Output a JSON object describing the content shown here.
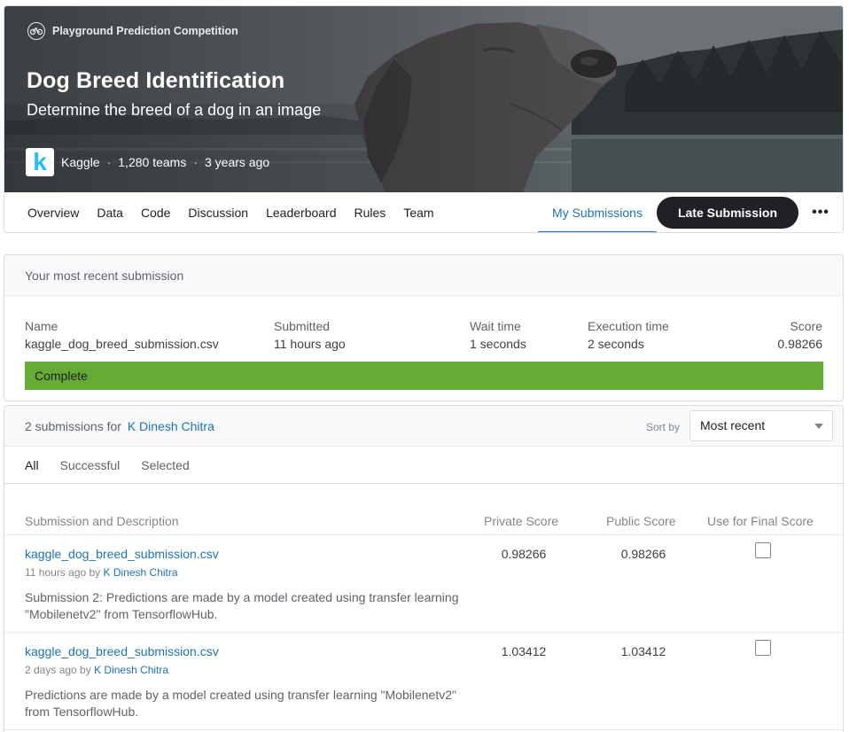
{
  "header": {
    "competition_type": "Playground Prediction Competition",
    "title": "Dog Breed Identification",
    "subtitle": "Determine the breed of a dog in an image",
    "host_logo_letter": "k",
    "host": "Kaggle",
    "teams": "1,280 teams",
    "age": "3 years ago",
    "separator": "·"
  },
  "tabs": {
    "overview": "Overview",
    "data": "Data",
    "code": "Code",
    "discussion": "Discussion",
    "leaderboard": "Leaderboard",
    "rules": "Rules",
    "team": "Team",
    "my_submissions": "My Submissions",
    "late_submission": "Late Submission",
    "more": "•••",
    "active": "My Submissions"
  },
  "recent": {
    "heading": "Your most recent submission",
    "name_label": "Name",
    "name_value": "kaggle_dog_breed_submission.csv",
    "submitted_label": "Submitted",
    "submitted_value": "11 hours ago",
    "wait_label": "Wait time",
    "wait_value": "1 seconds",
    "exec_label": "Execution time",
    "exec_value": "2 seconds",
    "score_label": "Score",
    "score_value": "0.98266",
    "status": "Complete",
    "status_color": "#66ab35"
  },
  "submissions": {
    "count_text": "2 submissions for",
    "user": "K Dinesh Chitra",
    "sort_label": "Sort by",
    "sort_value": "Most recent",
    "filters": [
      "All",
      "Successful",
      "Selected"
    ],
    "active_filter": "All",
    "columns": {
      "description": "Submission and Description",
      "private": "Private Score",
      "public": "Public Score",
      "final": "Use for Final Score"
    },
    "rows": [
      {
        "file": "kaggle_dog_breed_submission.csv",
        "time": "11 hours ago by",
        "user": "K Dinesh Chitra",
        "description": "Submission 2: Predictions are made by a model created using transfer learning \"Mobilenetv2\" from TensorflowHub.",
        "private_score": "0.98266",
        "public_score": "0.98266",
        "final": false
      },
      {
        "file": "kaggle_dog_breed_submission.csv",
        "time": "2 days ago by",
        "user": "K Dinesh Chitra",
        "description": "Predictions are made by a model created using transfer learning \"Mobilenetv2\" from TensorflowHub.",
        "private_score": "1.03412",
        "public_score": "1.03412",
        "final": false
      }
    ]
  },
  "colors": {
    "link": "#1e73b9",
    "late_button_bg": "#202124",
    "complete_bar": "#66ab35"
  }
}
